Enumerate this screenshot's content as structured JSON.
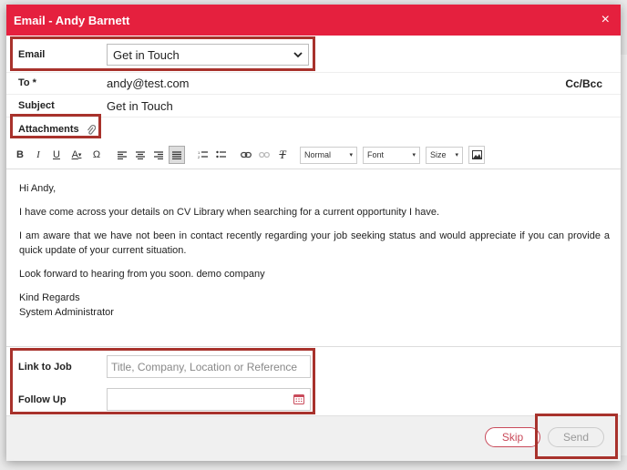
{
  "modal": {
    "title": "Email - Andy Barnett",
    "close_glyph": "×"
  },
  "form": {
    "email_label": "Email",
    "email_selected": "Get in Touch",
    "to_label": "To *",
    "to_value": "andy@test.com",
    "ccbcc_label": "Cc/Bcc",
    "subject_label": "Subject",
    "subject_value": "Get in Touch",
    "attachments_label": "Attachments"
  },
  "toolbar": {
    "bold": "B",
    "italic": "I",
    "underline": "U",
    "font_color": "A",
    "special_char": "Ω",
    "format_combo": "Normal",
    "font_combo": "Font",
    "size_combo": "Size",
    "remove_format": "T"
  },
  "editor": {
    "lines": [
      "Hi Andy,",
      "I have come across your details on CV Library when searching for a current opportunity I have.",
      "I am aware that we have not been in contact recently regarding your job seeking status and would appreciate if you can provide a quick update of your current situation.",
      "Look forward to hearing from you soon. demo company",
      "Kind Regards",
      "System Administrator"
    ]
  },
  "link_to_job": {
    "label": "Link to Job",
    "placeholder": "Title, Company, Location or Reference"
  },
  "follow_up": {
    "label": "Follow Up",
    "value": ""
  },
  "footer": {
    "skip_label": "Skip",
    "send_label": "Send"
  },
  "colors": {
    "titlebar": "#e5203e",
    "highlight": "#a8322c",
    "skip": "#c94a5a"
  }
}
